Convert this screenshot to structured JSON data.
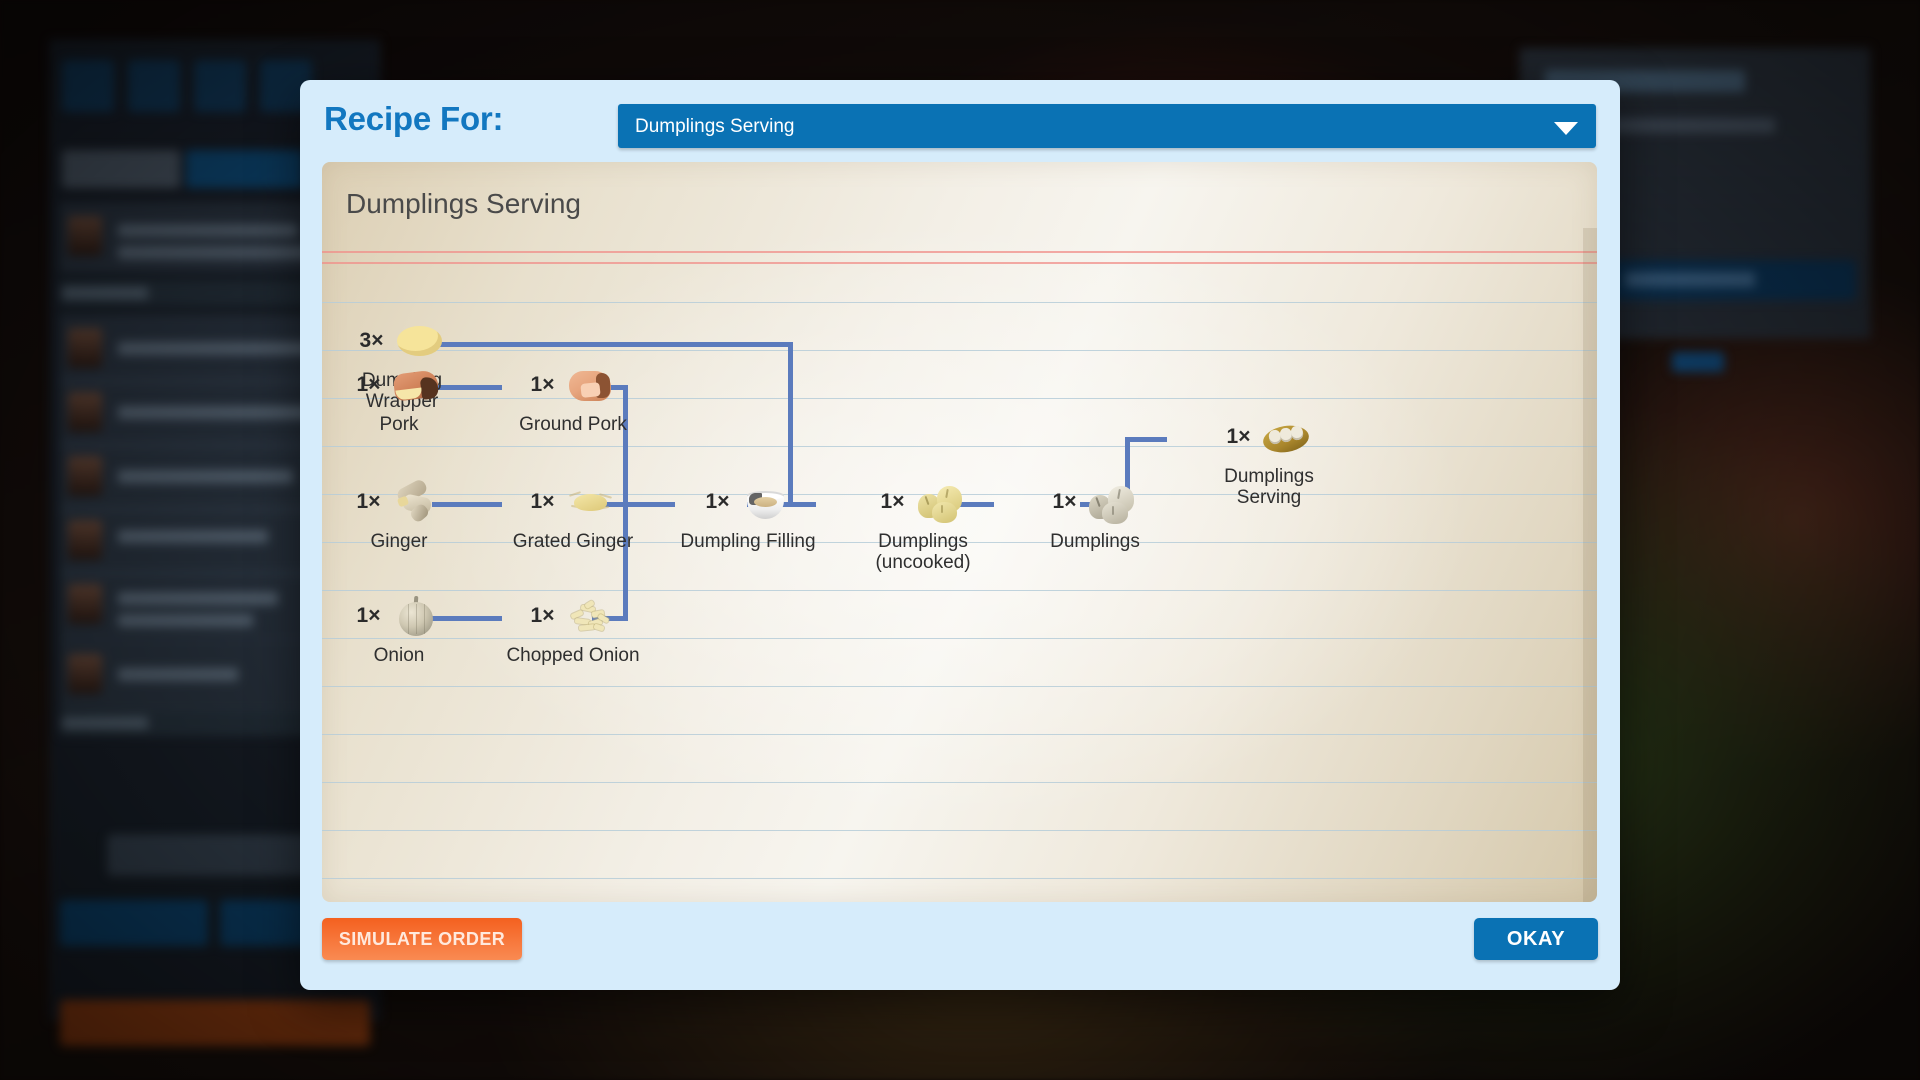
{
  "background": {
    "description": "blurred darkened game management UI behind modal"
  },
  "modal": {
    "header": {
      "title": "Recipe For:",
      "select": {
        "value": "Dumplings Serving",
        "arrow_icon": "chevron-down-icon"
      }
    },
    "paper": {
      "title": "Dumplings Serving"
    },
    "footer": {
      "simulate_order_label": "SIMULATE ORDER",
      "okay_label": "OKAY"
    }
  },
  "colors": {
    "modal_bg": "#d6ecfb",
    "accent_blue": "#0a72b4",
    "title_blue": "#1277c0",
    "connector_blue": "#5b7bbd",
    "orange_button": "#f4601f",
    "paper": "#f3efe6",
    "red_rule": "#f08f8a",
    "blue_rule": "#b6ccd8"
  },
  "recipe_tree": {
    "nodes": [
      {
        "id": "dumpling-wrapper",
        "qty": "3×",
        "label": "Dumpling\nWrapper",
        "icon": "dumpling-wrapper-icon"
      },
      {
        "id": "pork",
        "qty": "1×",
        "label": "Pork",
        "icon": "pork-icon"
      },
      {
        "id": "ground-pork",
        "qty": "1×",
        "label": "Ground Pork",
        "icon": "ground-pork-icon"
      },
      {
        "id": "ginger",
        "qty": "1×",
        "label": "Ginger",
        "icon": "ginger-icon"
      },
      {
        "id": "grated-ginger",
        "qty": "1×",
        "label": "Grated Ginger",
        "icon": "grated-ginger-icon"
      },
      {
        "id": "onion",
        "qty": "1×",
        "label": "Onion",
        "icon": "onion-icon"
      },
      {
        "id": "chopped-onion",
        "qty": "1×",
        "label": "Chopped Onion",
        "icon": "chopped-onion-icon"
      },
      {
        "id": "dumpling-filling",
        "qty": "1×",
        "label": "Dumpling Filling",
        "icon": "dumpling-filling-icon"
      },
      {
        "id": "dumplings-uncooked",
        "qty": "1×",
        "label": "Dumplings\n(uncooked)",
        "icon": "dumplings-uncooked-icon"
      },
      {
        "id": "dumplings",
        "qty": "1×",
        "label": "Dumplings",
        "icon": "dumplings-icon"
      },
      {
        "id": "dumplings-serving",
        "qty": "1×",
        "label": "Dumplings\nServing",
        "icon": "dumplings-serving-icon"
      }
    ]
  }
}
